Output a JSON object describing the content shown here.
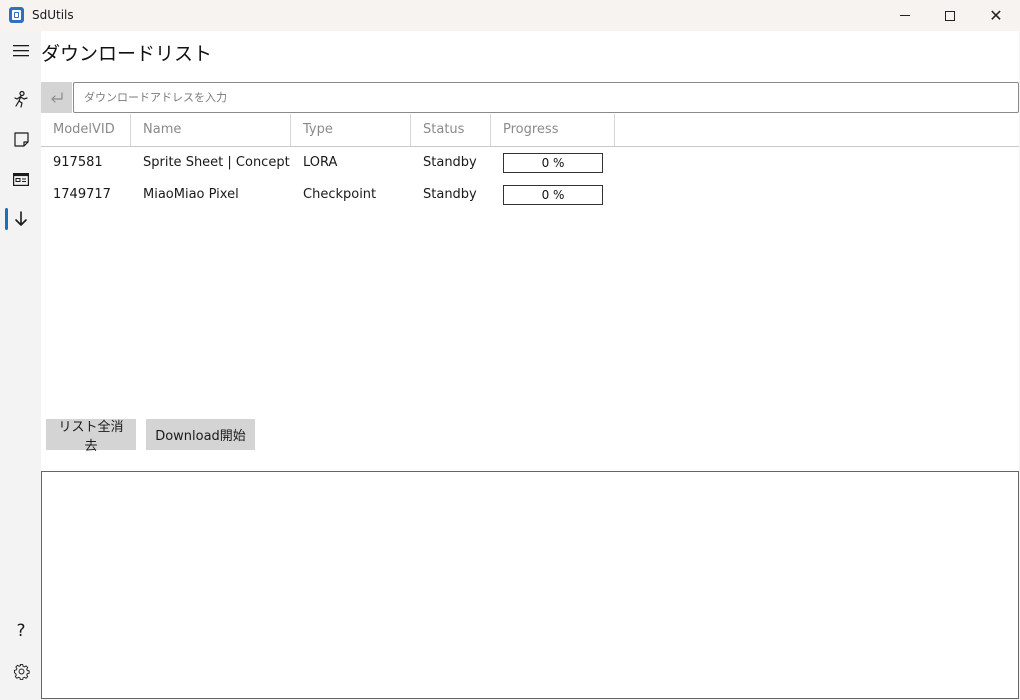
{
  "window": {
    "title": "SdUtils",
    "controls": {
      "minimize": "minimize-icon",
      "maximize": "maximize-icon",
      "close": "✕"
    }
  },
  "nav": {
    "menu_icon": "☰",
    "items": [
      {
        "name": "run-icon",
        "glyph": "🏃"
      },
      {
        "name": "note-icon",
        "glyph": "◻"
      },
      {
        "name": "card-icon",
        "glyph": "▤"
      },
      {
        "name": "download-icon",
        "glyph": "↓"
      }
    ],
    "help_icon": "?",
    "settings_icon": "⚙"
  },
  "page": {
    "title": "ダウンロードリスト"
  },
  "url_input": {
    "enter_glyph": "⏎",
    "placeholder": "ダウンロードアドレスを入力",
    "value": ""
  },
  "table": {
    "columns": [
      "ModelVID",
      "Name",
      "Type",
      "Status",
      "Progress"
    ],
    "rows": [
      {
        "id": "917581",
        "name": "Sprite Sheet | Concept P",
        "type": "LORA",
        "status": "Standby",
        "progress": 0,
        "progress_text": "0 %"
      },
      {
        "id": "1749717",
        "name": "MiaoMiao Pixel",
        "type": "Checkpoint",
        "status": "Standby",
        "progress": 0,
        "progress_text": "0 %"
      }
    ]
  },
  "actions": {
    "clear_label": "リスト全消去",
    "download_label": "Download開始"
  },
  "log": {
    "text": ""
  }
}
